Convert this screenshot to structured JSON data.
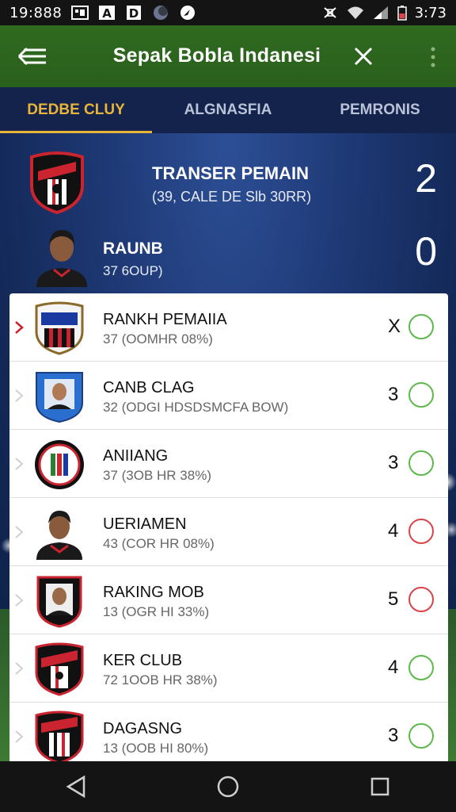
{
  "status_bar": {
    "time": "19:888",
    "clock": "3:73",
    "icons": [
      "gallery-icon",
      "a-icon",
      "d-icon",
      "moon-icon",
      "compass-icon",
      "vibrate-icon",
      "wifi-icon",
      "signal-icon",
      "battery-icon"
    ]
  },
  "app_bar": {
    "title": "Sepak Bobla Indanesi",
    "menu_icon": "menu-icon",
    "close_icon": "close-icon",
    "more_icon": "more-vertical-icon",
    "color": "#2f6a1f"
  },
  "tabs": [
    {
      "label": "DEDBE CLUY",
      "active": true
    },
    {
      "label": "ALGNASFIA",
      "active": false
    },
    {
      "label": "PEMRONIS",
      "active": false
    }
  ],
  "summary": [
    {
      "title": "TRANSER PEMAIN",
      "subtitle": "(39, CALE DE Slb 30RR)",
      "score": "2",
      "logo": "club-crest-icon"
    },
    {
      "title": "RAUNB",
      "subtitle": "37 6OUP)",
      "score": "0",
      "logo": "player-avatar-icon"
    }
  ],
  "list": [
    {
      "name": "RANKH PEMAIIA",
      "sub": "37 (OOMHR 08%)",
      "value": "X",
      "status": "green",
      "selected": true,
      "logo": "club-crest-icon"
    },
    {
      "name": "CANB CLAG",
      "sub": "32 (ODGI HDSDSMCFA BOW)",
      "value": "3",
      "status": "green",
      "selected": false,
      "logo": "player-badge-icon"
    },
    {
      "name": "ANIIANG",
      "sub": "37 (3OB HR 38%)",
      "value": "3",
      "status": "green",
      "selected": false,
      "logo": "round-crest-icon"
    },
    {
      "name": "UERIAMEN",
      "sub": "43 (COR HR 08%)",
      "value": "4",
      "status": "red",
      "selected": false,
      "logo": "player-avatar-icon"
    },
    {
      "name": "RAKING MOB",
      "sub": "13 (OGR HI 33%)",
      "value": "5",
      "status": "red",
      "selected": false,
      "logo": "shield-crest-icon"
    },
    {
      "name": "KER CLUB",
      "sub": "72 1OOB HR 38%)",
      "value": "4",
      "status": "green",
      "selected": false,
      "logo": "club-crest-icon"
    },
    {
      "name": "DAGASNG",
      "sub": "13 (OOB HI 80%)",
      "value": "3",
      "status": "green",
      "selected": false,
      "logo": "club-crest-icon"
    }
  ],
  "nav_bar": [
    "back-icon",
    "home-icon",
    "recents-icon"
  ],
  "colors": {
    "accent": "#e8b43a",
    "ok": "#5db84a",
    "bad": "#d9434a",
    "tabs_bg": "#13234c"
  }
}
